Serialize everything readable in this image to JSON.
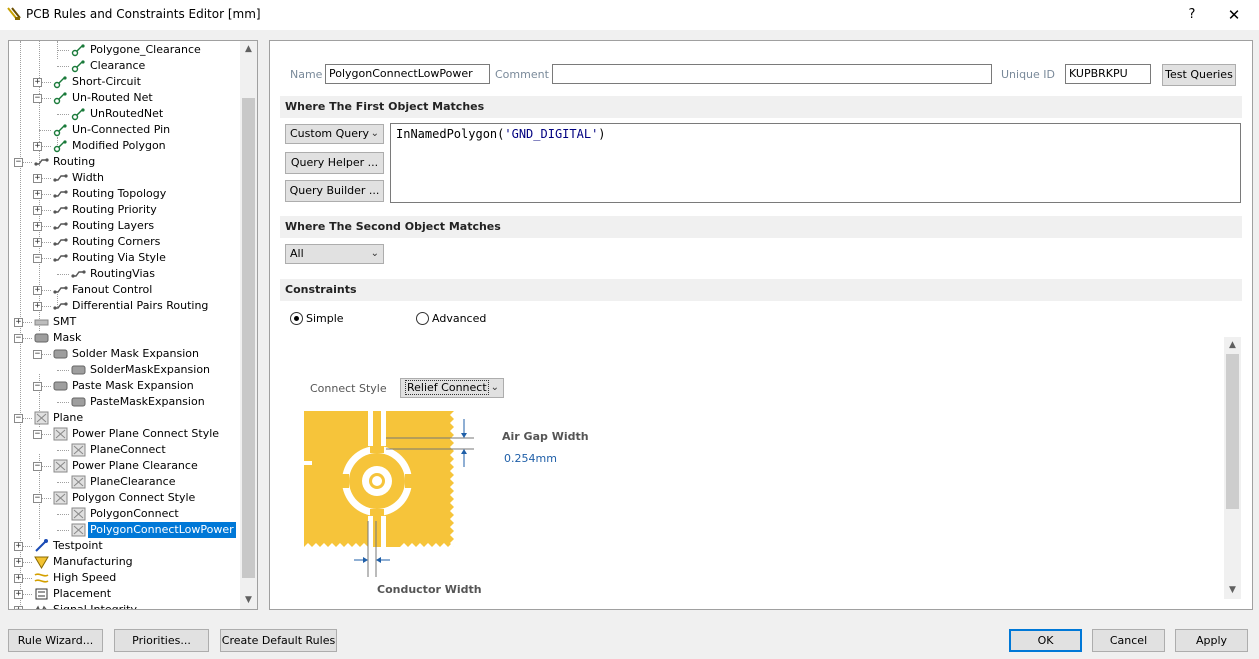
{
  "window": {
    "title": "PCB Rules and Constraints Editor [mm]",
    "help": "?",
    "close": "✕"
  },
  "tree": {
    "items": [
      {
        "label": "Polygone_Clearance"
      },
      {
        "label": "Clearance"
      },
      {
        "label": "Short-Circuit"
      },
      {
        "label": "Un-Routed Net"
      },
      {
        "label": "UnRoutedNet"
      },
      {
        "label": "Un-Connected Pin"
      },
      {
        "label": "Modified Polygon"
      },
      {
        "label": "Routing"
      },
      {
        "label": "Width"
      },
      {
        "label": "Routing Topology"
      },
      {
        "label": "Routing Priority"
      },
      {
        "label": "Routing Layers"
      },
      {
        "label": "Routing Corners"
      },
      {
        "label": "Routing Via Style"
      },
      {
        "label": "RoutingVias"
      },
      {
        "label": "Fanout Control"
      },
      {
        "label": "Differential Pairs Routing"
      },
      {
        "label": "SMT"
      },
      {
        "label": "Mask"
      },
      {
        "label": "Solder Mask Expansion"
      },
      {
        "label": "SolderMaskExpansion"
      },
      {
        "label": "Paste Mask Expansion"
      },
      {
        "label": "PasteMaskExpansion"
      },
      {
        "label": "Plane"
      },
      {
        "label": "Power Plane Connect Style"
      },
      {
        "label": "PlaneConnect"
      },
      {
        "label": "Power Plane Clearance"
      },
      {
        "label": "PlaneClearance"
      },
      {
        "label": "Polygon Connect Style"
      },
      {
        "label": "PolygonConnect"
      },
      {
        "label": "PolygonConnectLowPower"
      },
      {
        "label": "Testpoint"
      },
      {
        "label": "Manufacturing"
      },
      {
        "label": "High Speed"
      },
      {
        "label": "Placement"
      },
      {
        "label": "Signal Integrity"
      }
    ]
  },
  "rule": {
    "name_label": "Name",
    "name_value": "PolygonConnectLowPower",
    "comment_label": "Comment",
    "comment_value": "",
    "unique_id_label": "Unique ID",
    "unique_id_value": "KUPBRKPU",
    "test_queries": "Test Queries"
  },
  "first_match": {
    "header": "Where The First Object Matches",
    "query_type": "Custom Query",
    "query_helper": "Query Helper ...",
    "query_builder": "Query Builder ...",
    "query_fn": "InNamedPolygon(",
    "query_arg": "'GND_DIGITAL'",
    "query_close": ")"
  },
  "second_match": {
    "header": "Where The Second Object Matches",
    "value": "All"
  },
  "constraints": {
    "header": "Constraints",
    "simple": "Simple",
    "advanced": "Advanced",
    "mode": "simple",
    "connect_style_label": "Connect Style",
    "connect_style_value": "Relief Connect",
    "air_gap_label": "Air Gap Width",
    "air_gap_value": "0.254mm",
    "conductor_width_label": "Conductor Width",
    "copper_color": "#f6c43a"
  },
  "footer": {
    "rule_wizard": "Rule Wizard...",
    "priorities": "Priorities...",
    "create_default": "Create Default Rules",
    "ok": "OK",
    "cancel": "Cancel",
    "apply": "Apply"
  },
  "icons": {
    "app": "pcb-rules-icon",
    "rule": "rule-icon",
    "folder": "category-icon"
  }
}
